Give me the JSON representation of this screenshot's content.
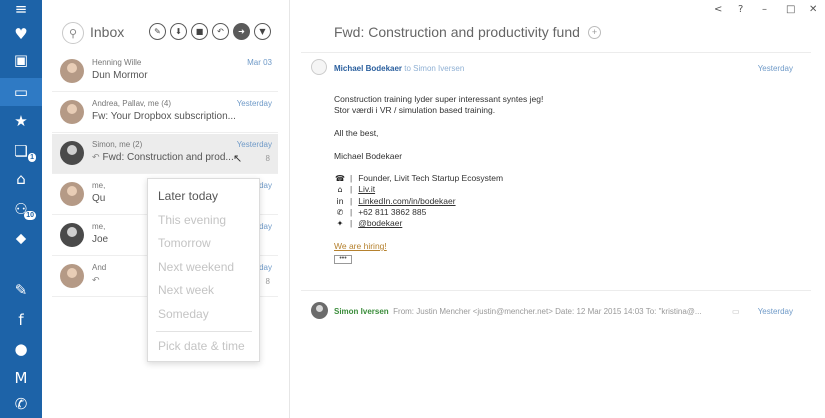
{
  "nav": {
    "items": [
      {
        "name": "menu-icon",
        "glyph": "≡"
      },
      {
        "name": "heart-icon",
        "glyph": "♥"
      },
      {
        "name": "briefcase-icon",
        "glyph": "▣"
      },
      {
        "name": "inbox-icon",
        "glyph": "▭"
      },
      {
        "name": "star-icon",
        "glyph": "★"
      },
      {
        "name": "files-icon",
        "glyph": "❏",
        "badge": "1"
      },
      {
        "name": "tray-icon",
        "glyph": "⌂"
      },
      {
        "name": "people-icon",
        "glyph": "⚇",
        "badge": "10"
      },
      {
        "name": "tag-icon",
        "glyph": "⬥"
      },
      {
        "name": "evernote-icon",
        "glyph": "✎"
      },
      {
        "name": "facebook-icon",
        "glyph": "f"
      },
      {
        "name": "circle-icon",
        "glyph": "●"
      },
      {
        "name": "gmail-icon",
        "glyph": "M"
      },
      {
        "name": "whatsapp-icon",
        "glyph": "✆"
      }
    ]
  },
  "list": {
    "title": "Inbox",
    "tools": [
      {
        "name": "compose-icon",
        "glyph": "✎"
      },
      {
        "name": "download-icon",
        "glyph": "⬇"
      },
      {
        "name": "trash-icon",
        "glyph": "■"
      },
      {
        "name": "undo-icon",
        "glyph": "↶"
      },
      {
        "name": "forward-icon",
        "glyph": "➜"
      },
      {
        "name": "more-icon",
        "glyph": "▼"
      }
    ],
    "messages": [
      {
        "from": "Henning Wille",
        "date": "Mar 03",
        "subject": "Dun Mormor",
        "count": ""
      },
      {
        "from": "Andrea, Pallav, me  (4)",
        "date": "Yesterday",
        "subject": "Fw: Your Dropbox subscription...",
        "count": ""
      },
      {
        "from": "Simon, me  (2)",
        "date": "Yesterday",
        "subject": "Fwd: Construction and prod...",
        "count": "8"
      },
      {
        "from": "me,",
        "date": "Yesterday",
        "subject": "Qu",
        "count": ""
      },
      {
        "from": "me,",
        "date": "Tuesday",
        "subject": "Joe",
        "count": ""
      },
      {
        "from": "And",
        "date": "Monday",
        "subject": "",
        "count": "8"
      }
    ]
  },
  "snooze": {
    "options": [
      "Later today",
      "This evening",
      "Tomorrow",
      "Next weekend",
      "Next week",
      "Someday"
    ],
    "pick": "Pick date & time"
  },
  "detail": {
    "title": "Fwd: Construction and productivity fund",
    "sender": {
      "name": "Michael Bodekaer",
      "to": "to Simon Iversen",
      "date": "Yesterday"
    },
    "body": [
      "Construction training lyder super interessant syntes jeg!",
      "Stor værdi i VR / simulation based training.",
      "All the best,",
      "Michael Bodekaer"
    ],
    "signature": [
      {
        "icon": "person-icon",
        "glyph": "☎",
        "text": "Founder, Livit Tech Startup Ecosystem",
        "link": false
      },
      {
        "icon": "home-icon",
        "glyph": "⌂",
        "text": "Liv.it",
        "link": true
      },
      {
        "icon": "linkedin-icon",
        "glyph": "in",
        "text": "LinkedIn.com/in/bodekaer",
        "link": true
      },
      {
        "icon": "phone-icon",
        "glyph": "✆",
        "text": "+62 811 3862 885",
        "link": false
      },
      {
        "icon": "twitter-icon",
        "glyph": "✦",
        "text": "@bodekaer",
        "link": true
      }
    ],
    "hiring": "We are hiring!",
    "ellipsis": "•••",
    "thread": {
      "name": "Simon Iversen",
      "meta": "From: Justin Mencher <justin@mencher.net> Date: 12 Mar 2015 14:03 To: \"kristina@...",
      "date": "Yesterday"
    }
  },
  "window": {
    "back": "<",
    "help": "?",
    "minimize": "–",
    "maximize": "□",
    "close": "✕"
  }
}
